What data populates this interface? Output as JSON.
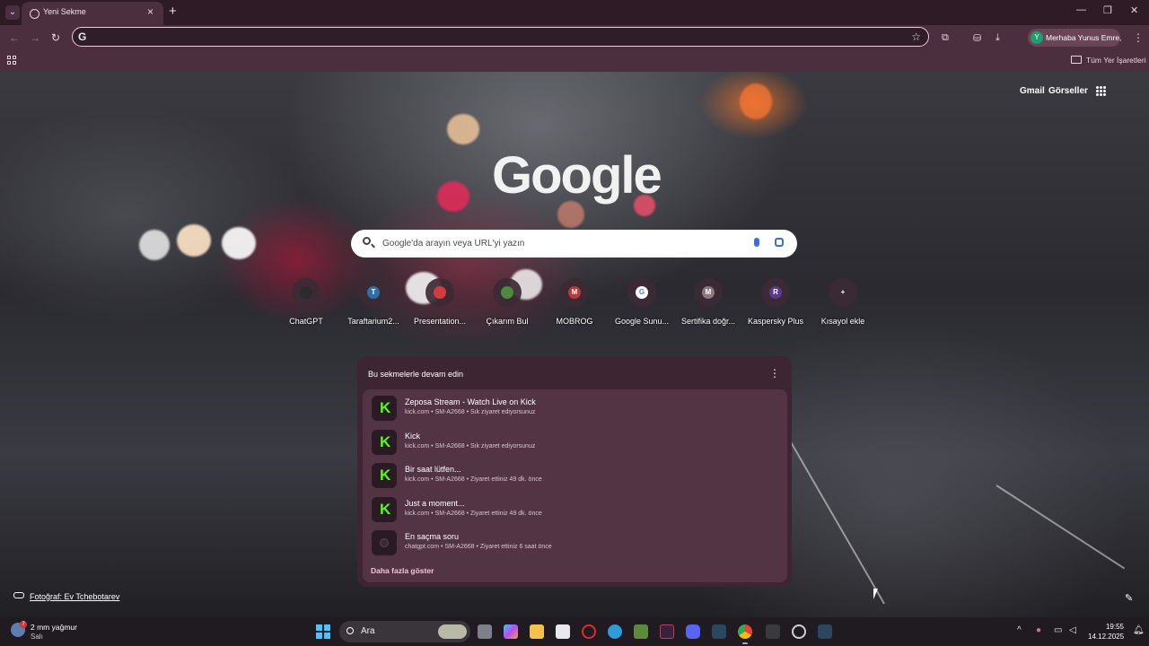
{
  "browser": {
    "tab_title": "Yeni Sekme",
    "omnibox_value": "",
    "profile_initial": "Y",
    "profile_label": "Merhaba Yunus Emre,",
    "all_bookmarks": "Tüm Yer İşaretleri"
  },
  "ntp": {
    "links": {
      "gmail": "Gmail",
      "images": "Görseller"
    },
    "logo": "Google",
    "search_placeholder": "Google'da arayın veya URL'yi yazın",
    "shortcuts": [
      {
        "label": "ChatGPT",
        "letter": "",
        "color": "#2b2b2b"
      },
      {
        "label": "Taraftarium2...",
        "letter": "T",
        "color": "#2f6fa8"
      },
      {
        "label": "Presentation...",
        "letter": "",
        "color": "#d33c3c"
      },
      {
        "label": "Çıkarım Bul",
        "letter": "",
        "color": "#4c8a3c"
      },
      {
        "label": "MOBROG",
        "letter": "M",
        "color": "#b83b3b"
      },
      {
        "label": "Google Sunu...",
        "letter": "G",
        "color": "#ffffff"
      },
      {
        "label": "Sertifika doğr...",
        "letter": "M",
        "color": "#8a7a80"
      },
      {
        "label": "Kaspersky Plus",
        "letter": "R",
        "color": "#5a3b8a"
      },
      {
        "label": "Kısayol ekle",
        "letter": "+",
        "color": "transparent"
      }
    ],
    "continue_card": {
      "title": "Bu sekmelerle devam edin",
      "items": [
        {
          "title": "Zeposa Stream - Watch Live on Kick",
          "sub": "kick.com • SM-A2668 • Sık ziyaret ediyorsunuz",
          "icon": "kick"
        },
        {
          "title": "Kick",
          "sub": "kick.com • SM-A2668 • Sık ziyaret ediyorsunuz",
          "icon": "kick"
        },
        {
          "title": "Bir saat lütfen...",
          "sub": "kick.com • SM-A2668 • Ziyaret ettiniz 49 dk. önce",
          "icon": "kick"
        },
        {
          "title": "Just a moment...",
          "sub": "kick.com • SM-A2668 • Ziyaret ettiniz 49 dk. önce",
          "icon": "kick"
        },
        {
          "title": "En saçma soru",
          "sub": "chatgpt.com • SM-A2668 • Ziyaret ettiniz 6 saat önce",
          "icon": "chatgpt"
        }
      ],
      "more": "Daha fazla göster"
    },
    "photo_credit": "Fotoğraf: Ev Tchebotarev"
  },
  "taskbar": {
    "weather_badge": "7",
    "weather_line1": "2 mm yağmur",
    "weather_line2": "Salı",
    "search_label": "Ara",
    "time": "19:55",
    "date": "14.12.2025"
  }
}
